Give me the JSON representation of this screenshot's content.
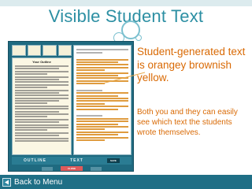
{
  "slide": {
    "title": "Visible Student Text",
    "description_primary": "Student-generated text is orangey brownish yellow.",
    "description_secondary": "Both you and they can easily see which text the students wrote themselves.",
    "back_label": "Back to Menu"
  },
  "embedded_app": {
    "left_panel_heading": "Your Outline",
    "footer": {
      "outline_label": "OUTLINE",
      "text_label": "TEXT",
      "save_label": "SAVE"
    },
    "close_label": "CLOSE"
  },
  "colors": {
    "title": "#2c8fa3",
    "student_text": "#d96a05",
    "footer_bar": "#1f6f86",
    "app_frame": "#1f6a80"
  },
  "icons": {
    "back": "triangle-left-icon"
  }
}
